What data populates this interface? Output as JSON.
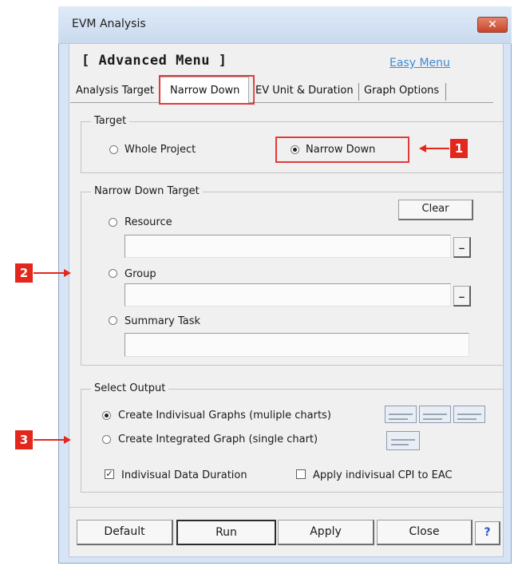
{
  "window": {
    "title": "EVM Analysis",
    "close_glyph": "✕"
  },
  "menu": {
    "title": "[ Advanced Menu ]",
    "easy_link": "Easy Menu"
  },
  "tabs": [
    {
      "label": "Analysis Target",
      "active": false
    },
    {
      "label": "Narrow Down",
      "active": true
    },
    {
      "label": "EV Unit & Duration",
      "active": false
    },
    {
      "label": "Graph Options",
      "active": false
    }
  ],
  "target": {
    "legend": "Target",
    "options": [
      {
        "label": "Whole Project",
        "selected": false
      },
      {
        "label": "Narrow Down",
        "selected": true
      }
    ]
  },
  "narrow": {
    "legend": "Narrow Down Target",
    "clear_label": "Clear",
    "browse_glyph": "_",
    "resource": {
      "label": "Resource",
      "selected": false,
      "value": ""
    },
    "group": {
      "label": "Group",
      "selected": false,
      "value": ""
    },
    "summary": {
      "label": "Summary Task",
      "selected": false,
      "value": ""
    }
  },
  "output": {
    "legend": "Select Output",
    "options": [
      {
        "label": "Create Indivisual Graphs (muliple charts)",
        "selected": true,
        "icon": "multiple-charts-icon"
      },
      {
        "label": "Create Integrated Graph (single chart)",
        "selected": false,
        "icon": "single-chart-icon"
      }
    ],
    "checks": [
      {
        "label": "Indivisual Data Duration",
        "checked": true
      },
      {
        "label": "Apply indivisual CPI to EAC",
        "checked": false
      }
    ],
    "check_glyph": "✓"
  },
  "buttons": {
    "default": "Default",
    "run": "Run",
    "apply": "Apply",
    "close": "Close",
    "help": "?"
  },
  "annotations": {
    "one": "1",
    "two": "2",
    "three": "3"
  },
  "colors": {
    "highlight": "#e23a3a",
    "badge": "#e3271d",
    "link": "#3d8ad4"
  }
}
